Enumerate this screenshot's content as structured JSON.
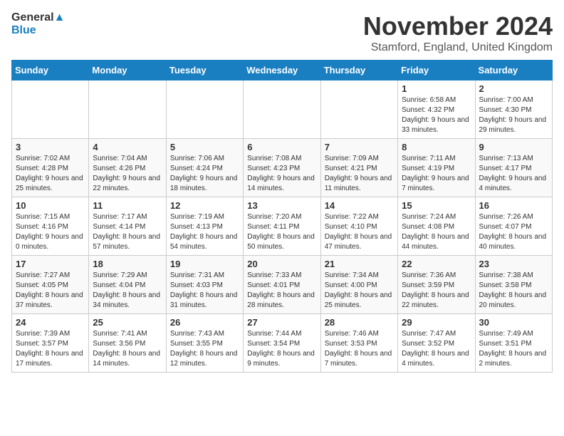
{
  "logo": {
    "line1": "General",
    "line2": "Blue"
  },
  "title": "November 2024",
  "location": "Stamford, England, United Kingdom",
  "days_of_week": [
    "Sunday",
    "Monday",
    "Tuesday",
    "Wednesday",
    "Thursday",
    "Friday",
    "Saturday"
  ],
  "weeks": [
    [
      {
        "day": "",
        "info": ""
      },
      {
        "day": "",
        "info": ""
      },
      {
        "day": "",
        "info": ""
      },
      {
        "day": "",
        "info": ""
      },
      {
        "day": "",
        "info": ""
      },
      {
        "day": "1",
        "info": "Sunrise: 6:58 AM\nSunset: 4:32 PM\nDaylight: 9 hours and 33 minutes."
      },
      {
        "day": "2",
        "info": "Sunrise: 7:00 AM\nSunset: 4:30 PM\nDaylight: 9 hours and 29 minutes."
      }
    ],
    [
      {
        "day": "3",
        "info": "Sunrise: 7:02 AM\nSunset: 4:28 PM\nDaylight: 9 hours and 25 minutes."
      },
      {
        "day": "4",
        "info": "Sunrise: 7:04 AM\nSunset: 4:26 PM\nDaylight: 9 hours and 22 minutes."
      },
      {
        "day": "5",
        "info": "Sunrise: 7:06 AM\nSunset: 4:24 PM\nDaylight: 9 hours and 18 minutes."
      },
      {
        "day": "6",
        "info": "Sunrise: 7:08 AM\nSunset: 4:23 PM\nDaylight: 9 hours and 14 minutes."
      },
      {
        "day": "7",
        "info": "Sunrise: 7:09 AM\nSunset: 4:21 PM\nDaylight: 9 hours and 11 minutes."
      },
      {
        "day": "8",
        "info": "Sunrise: 7:11 AM\nSunset: 4:19 PM\nDaylight: 9 hours and 7 minutes."
      },
      {
        "day": "9",
        "info": "Sunrise: 7:13 AM\nSunset: 4:17 PM\nDaylight: 9 hours and 4 minutes."
      }
    ],
    [
      {
        "day": "10",
        "info": "Sunrise: 7:15 AM\nSunset: 4:16 PM\nDaylight: 9 hours and 0 minutes."
      },
      {
        "day": "11",
        "info": "Sunrise: 7:17 AM\nSunset: 4:14 PM\nDaylight: 8 hours and 57 minutes."
      },
      {
        "day": "12",
        "info": "Sunrise: 7:19 AM\nSunset: 4:13 PM\nDaylight: 8 hours and 54 minutes."
      },
      {
        "day": "13",
        "info": "Sunrise: 7:20 AM\nSunset: 4:11 PM\nDaylight: 8 hours and 50 minutes."
      },
      {
        "day": "14",
        "info": "Sunrise: 7:22 AM\nSunset: 4:10 PM\nDaylight: 8 hours and 47 minutes."
      },
      {
        "day": "15",
        "info": "Sunrise: 7:24 AM\nSunset: 4:08 PM\nDaylight: 8 hours and 44 minutes."
      },
      {
        "day": "16",
        "info": "Sunrise: 7:26 AM\nSunset: 4:07 PM\nDaylight: 8 hours and 40 minutes."
      }
    ],
    [
      {
        "day": "17",
        "info": "Sunrise: 7:27 AM\nSunset: 4:05 PM\nDaylight: 8 hours and 37 minutes."
      },
      {
        "day": "18",
        "info": "Sunrise: 7:29 AM\nSunset: 4:04 PM\nDaylight: 8 hours and 34 minutes."
      },
      {
        "day": "19",
        "info": "Sunrise: 7:31 AM\nSunset: 4:03 PM\nDaylight: 8 hours and 31 minutes."
      },
      {
        "day": "20",
        "info": "Sunrise: 7:33 AM\nSunset: 4:01 PM\nDaylight: 8 hours and 28 minutes."
      },
      {
        "day": "21",
        "info": "Sunrise: 7:34 AM\nSunset: 4:00 PM\nDaylight: 8 hours and 25 minutes."
      },
      {
        "day": "22",
        "info": "Sunrise: 7:36 AM\nSunset: 3:59 PM\nDaylight: 8 hours and 22 minutes."
      },
      {
        "day": "23",
        "info": "Sunrise: 7:38 AM\nSunset: 3:58 PM\nDaylight: 8 hours and 20 minutes."
      }
    ],
    [
      {
        "day": "24",
        "info": "Sunrise: 7:39 AM\nSunset: 3:57 PM\nDaylight: 8 hours and 17 minutes."
      },
      {
        "day": "25",
        "info": "Sunrise: 7:41 AM\nSunset: 3:56 PM\nDaylight: 8 hours and 14 minutes."
      },
      {
        "day": "26",
        "info": "Sunrise: 7:43 AM\nSunset: 3:55 PM\nDaylight: 8 hours and 12 minutes."
      },
      {
        "day": "27",
        "info": "Sunrise: 7:44 AM\nSunset: 3:54 PM\nDaylight: 8 hours and 9 minutes."
      },
      {
        "day": "28",
        "info": "Sunrise: 7:46 AM\nSunset: 3:53 PM\nDaylight: 8 hours and 7 minutes."
      },
      {
        "day": "29",
        "info": "Sunrise: 7:47 AM\nSunset: 3:52 PM\nDaylight: 8 hours and 4 minutes."
      },
      {
        "day": "30",
        "info": "Sunrise: 7:49 AM\nSunset: 3:51 PM\nDaylight: 8 hours and 2 minutes."
      }
    ]
  ]
}
